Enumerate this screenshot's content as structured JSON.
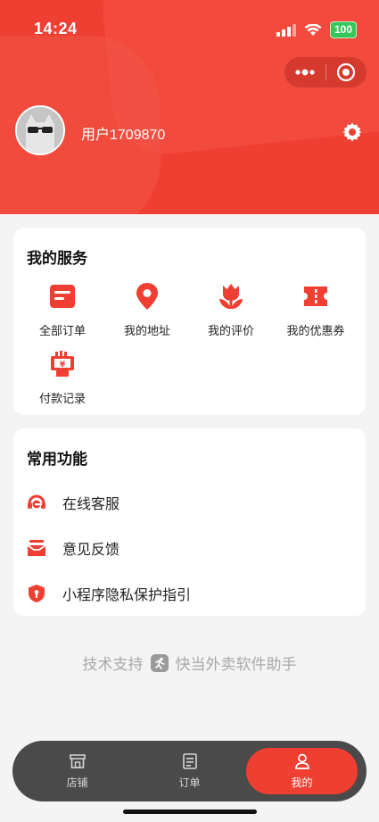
{
  "status_bar": {
    "time": "14:24",
    "battery": "100"
  },
  "profile": {
    "username": "用户1709870"
  },
  "services": {
    "title": "我的服务",
    "items": [
      {
        "label": "全部订单",
        "icon": "order-list-icon"
      },
      {
        "label": "我的地址",
        "icon": "location-pin-icon"
      },
      {
        "label": "我的评价",
        "icon": "flower-icon"
      },
      {
        "label": "我的优惠券",
        "icon": "coupon-icon"
      },
      {
        "label": "付款记录",
        "icon": "payment-record-icon"
      }
    ]
  },
  "functions": {
    "title": "常用功能",
    "items": [
      {
        "label": "在线客服",
        "icon": "headset-icon"
      },
      {
        "label": "意见反馈",
        "icon": "inbox-icon"
      },
      {
        "label": "小程序隐私保护指引",
        "icon": "shield-icon"
      }
    ]
  },
  "footer": {
    "prefix": "技术支持",
    "brand": "快当外卖软件助手"
  },
  "tabbar": {
    "items": [
      {
        "label": "店铺",
        "icon": "store-icon"
      },
      {
        "label": "订单",
        "icon": "order-icon"
      },
      {
        "label": "我的",
        "icon": "user-icon",
        "active": true
      }
    ]
  },
  "colors": {
    "accent": "#ef3e32",
    "background": "#f4f4f4",
    "tabbar": "#4a4a4a"
  }
}
